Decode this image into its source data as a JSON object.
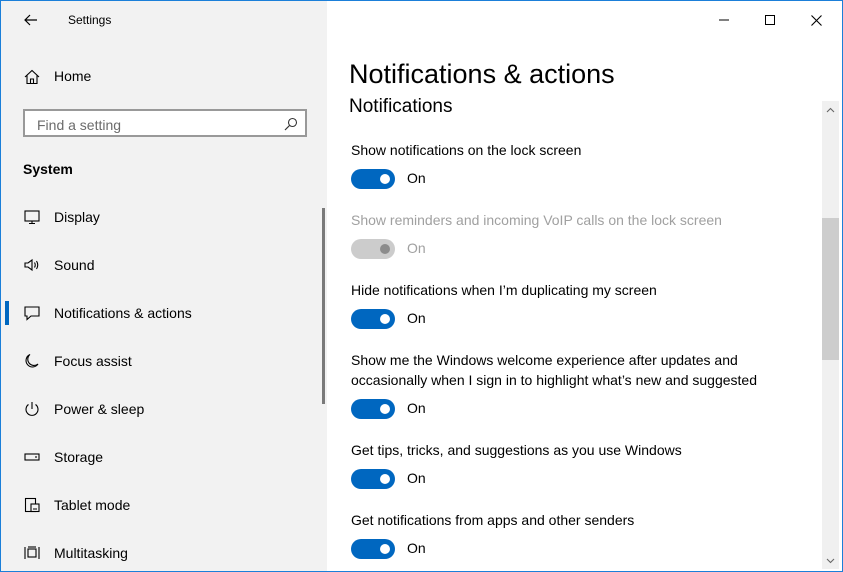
{
  "window": {
    "title": "Settings"
  },
  "sidebar": {
    "home_label": "Home",
    "search_placeholder": "Find a setting",
    "section_title": "System",
    "items": [
      {
        "label": "Display",
        "icon": "display-icon"
      },
      {
        "label": "Sound",
        "icon": "sound-icon"
      },
      {
        "label": "Notifications & actions",
        "icon": "notifications-icon",
        "active": true
      },
      {
        "label": "Focus assist",
        "icon": "moon-icon"
      },
      {
        "label": "Power & sleep",
        "icon": "power-icon"
      },
      {
        "label": "Storage",
        "icon": "storage-icon"
      },
      {
        "label": "Tablet mode",
        "icon": "tablet-mode-icon"
      },
      {
        "label": "Multitasking",
        "icon": "multitasking-icon"
      }
    ]
  },
  "main": {
    "page_title": "Notifications & actions",
    "section_title": "Notifications",
    "settings": [
      {
        "label": "Show notifications on the lock screen",
        "state": "On",
        "enabled": true
      },
      {
        "label": "Show reminders and incoming VoIP calls on the lock screen",
        "state": "On",
        "enabled": false
      },
      {
        "label": "Hide notifications when I’m duplicating my screen",
        "state": "On",
        "enabled": true
      },
      {
        "label": "Show me the Windows welcome experience after updates and occasionally when I sign in to highlight what’s new and suggested",
        "state": "On",
        "enabled": true
      },
      {
        "label": "Get tips, tricks, and suggestions as you use Windows",
        "state": "On",
        "enabled": true
      },
      {
        "label": "Get notifications from apps and other senders",
        "state": "On",
        "enabled": true
      }
    ]
  },
  "colors": {
    "accent": "#0067c0",
    "sidebar_bg": "#f2f2f2",
    "disabled": "#a0a0a0"
  }
}
